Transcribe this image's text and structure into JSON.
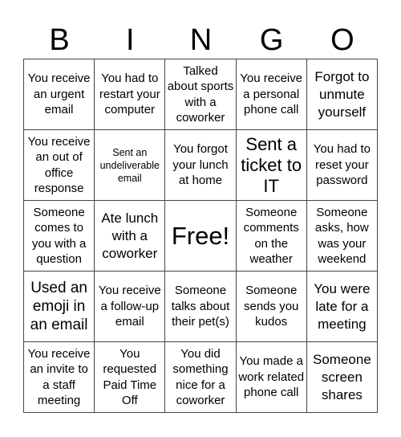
{
  "title_letters": [
    "B",
    "I",
    "N",
    "G",
    "O"
  ],
  "cells": [
    {
      "text": "You receive an urgent email",
      "size": "s15"
    },
    {
      "text": "You had to restart your computer",
      "size": "s15"
    },
    {
      "text": "Talked about sports with a coworker",
      "size": "s15"
    },
    {
      "text": "You receive a personal phone call",
      "size": "s15"
    },
    {
      "text": "Forgot to unmute yourself",
      "size": "s17"
    },
    {
      "text": "You receive an out of office response",
      "size": "s15"
    },
    {
      "text": "Sent an undeliverable email",
      "size": "s12"
    },
    {
      "text": "You forgot your lunch at home",
      "size": "s15"
    },
    {
      "text": "Sent a ticket to IT",
      "size": "s22"
    },
    {
      "text": "You had to reset your password",
      "size": "s15"
    },
    {
      "text": "Someone comes to you with a question",
      "size": "s15"
    },
    {
      "text": "Ate lunch with a coworker",
      "size": "s17"
    },
    {
      "text": "Free!",
      "size": "s30"
    },
    {
      "text": "Someone comments on the weather",
      "size": "s15"
    },
    {
      "text": "Someone asks, how was your weekend",
      "size": "s15"
    },
    {
      "text": "Used an emoji in an email",
      "size": "s19"
    },
    {
      "text": "You receive a follow-up email",
      "size": "s15"
    },
    {
      "text": "Someone talks about their pet(s)",
      "size": "s15"
    },
    {
      "text": "Someone sends you kudos",
      "size": "s15"
    },
    {
      "text": "You were late for a meeting",
      "size": "s17"
    },
    {
      "text": "You receive an invite to a staff meeting",
      "size": "s15"
    },
    {
      "text": "You requested Paid Time Off",
      "size": "s15"
    },
    {
      "text": "You did something nice for a coworker",
      "size": "s15"
    },
    {
      "text": "You made a work related phone call",
      "size": "s15"
    },
    {
      "text": "Someone screen shares",
      "size": "s17"
    }
  ]
}
